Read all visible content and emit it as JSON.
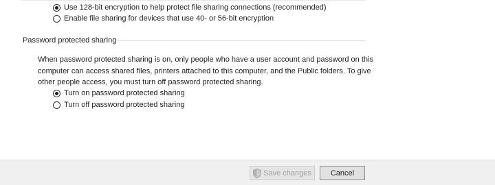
{
  "encryption": {
    "options": [
      {
        "label": "Use 128-bit encryption to help protect file sharing connections (recommended)",
        "selected": true
      },
      {
        "label": "Enable file sharing for devices that use 40- or 56-bit encryption",
        "selected": false
      }
    ]
  },
  "password_sharing": {
    "header": "Password protected sharing",
    "description": "When password protected sharing is on, only people who have a user account and password on this computer can access shared files, printers attached to this computer, and the Public folders. To give other people access, you must turn off password protected sharing.",
    "options": [
      {
        "label": "Turn on password protected sharing",
        "selected": true
      },
      {
        "label": "Turn off password protected sharing",
        "selected": false
      }
    ]
  },
  "footer": {
    "save_label": "Save changes",
    "save_enabled": false,
    "cancel_label": "Cancel"
  },
  "icons": {
    "save": "uac-shield-icon"
  },
  "colors": {
    "background": "#ffffff",
    "footer": "#f0f0f0",
    "disabled_text": "#a0a0a0"
  }
}
